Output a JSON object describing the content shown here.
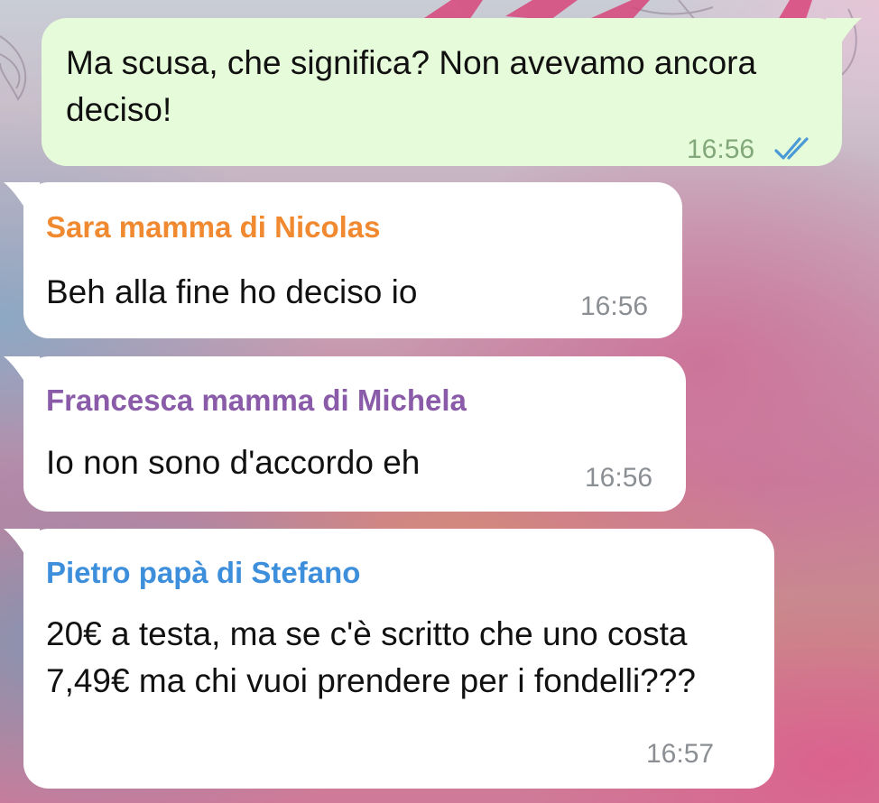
{
  "colors": {
    "outgoing_bubble": "#e6fbd9",
    "incoming_bubble": "#ffffff",
    "read_ticks": "#4a9ad6",
    "time_outgoing": "#82a77a",
    "time_incoming": "#8b8f93"
  },
  "messages": [
    {
      "direction": "outgoing",
      "text": "Ma scusa, che significa? Non avevamo ancora deciso!",
      "time": "16:56",
      "status_icon": "double-check-icon"
    },
    {
      "direction": "incoming",
      "sender": "Sara mamma di Nicolas",
      "sender_color": "#f0892f",
      "text": "Beh alla fine ho deciso io",
      "time": "16:56"
    },
    {
      "direction": "incoming",
      "sender": "Francesca mamma di Michela",
      "sender_color": "#8a5ba8",
      "text": "Io non sono d'accordo eh",
      "time": "16:56"
    },
    {
      "direction": "incoming",
      "sender": "Pietro papà di Stefano",
      "sender_color": "#3d8fdc",
      "text": "20€ a testa, ma se c'è scritto che uno costa 7,49€ ma chi vuoi prendere per i fondelli???",
      "time": "16:57"
    }
  ]
}
